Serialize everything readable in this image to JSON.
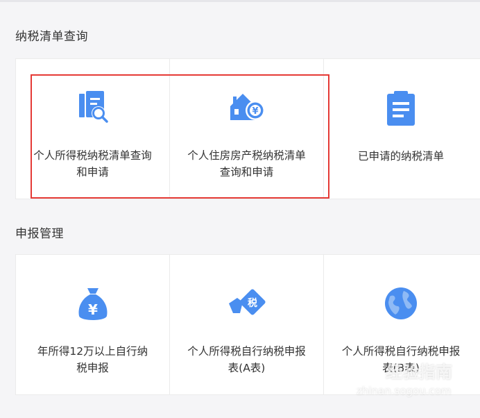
{
  "sections": [
    {
      "title": "纳税清单查询",
      "items": [
        {
          "icon": "document-search-icon",
          "label": "个人所得税纳税清单查询和申请"
        },
        {
          "icon": "house-yuan-icon",
          "label": "个人住房房产税纳税清单查询和申请"
        },
        {
          "icon": "clipboard-list-icon",
          "label": "已申请的纳税清单"
        }
      ]
    },
    {
      "title": "申报管理",
      "items": [
        {
          "icon": "money-bag-yuan-icon",
          "label": "年所得12万以上自行纳税申报"
        },
        {
          "icon": "hand-tax-tag-icon",
          "label": "个人所得税自行纳税申报表(A表)"
        },
        {
          "icon": "globe-icon",
          "label": "个人所得税自行纳税申报表(B表)"
        }
      ]
    }
  ],
  "colors": {
    "accent": "#4a8ef0",
    "highlight": "#e53935"
  },
  "watermark": {
    "text": "经验指南",
    "url": "zhinan.sogou.com"
  }
}
